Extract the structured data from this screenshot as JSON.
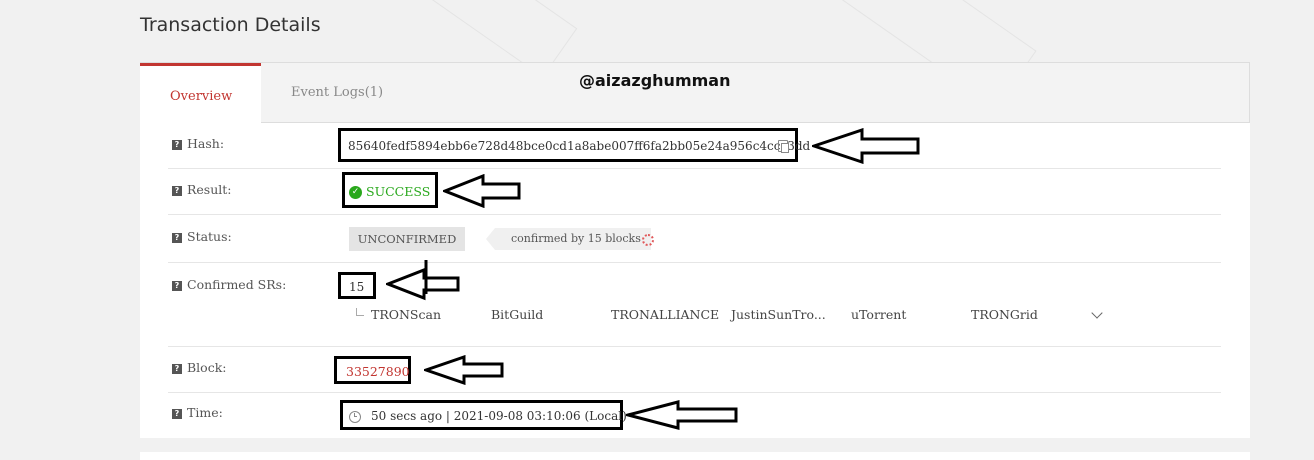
{
  "page": {
    "title": "Transaction Details"
  },
  "tabs": [
    {
      "label": "Overview",
      "active": true
    },
    {
      "label": "Event Logs(1)",
      "active": false
    }
  ],
  "watermark": "@aizazghumman",
  "help_icon_glyph": "?",
  "rows": {
    "hash": {
      "label": "Hash:",
      "value": "85640fedf5894ebb6e728d48bce0cd1a8abe007ff6fa2bb05e24a956c4ccc3dd",
      "copy_icon": "copy-icon"
    },
    "result": {
      "label": "Result:",
      "value": "SUCCESS",
      "icon": "check-circle-icon",
      "icon_glyph": "✓",
      "color": "#29a81c"
    },
    "status": {
      "label": "Status:",
      "badge": "UNCONFIRMED",
      "confirmations": "confirmed by 15 blocks",
      "spinner": "loading-spinner-icon"
    },
    "confirmed_srs": {
      "label": "Confirmed SRs:",
      "count": "15",
      "list": [
        "TRONScan",
        "BitGuild",
        "TRONALLIANCE",
        "JustinSunTro...",
        "uTorrent",
        "TRONGrid"
      ],
      "expand_icon": "chevron-down-icon"
    },
    "block": {
      "label": "Block:",
      "value": "33527890",
      "color": "#c23631"
    },
    "time": {
      "label": "Time:",
      "value": "50 secs ago | 2021-09-08 03:10:06 (Local)",
      "icon": "clock-icon"
    }
  },
  "colors": {
    "accent": "#c23631",
    "success": "#29a81c",
    "annotation": "#000000"
  }
}
